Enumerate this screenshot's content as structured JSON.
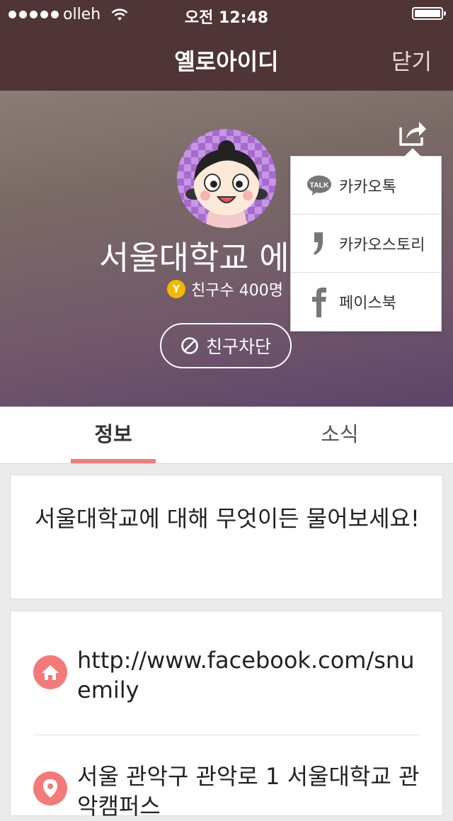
{
  "status": {
    "carrier": "olleh",
    "time": "오전 12:48"
  },
  "nav": {
    "title": "옐로아이디",
    "close_label": "닫기"
  },
  "profile": {
    "name": "서울대학교 에",
    "friends_badge": "Y",
    "friends_text": "친구수 400명",
    "block_label": "친구차단"
  },
  "share_menu": {
    "items": [
      {
        "icon": "kakaotalk-icon",
        "label": "카카오톡"
      },
      {
        "icon": "kakaostory-icon",
        "label": "카카오스토리"
      },
      {
        "icon": "facebook-icon",
        "label": "페이스북"
      }
    ]
  },
  "tabs": [
    {
      "label": "정보",
      "active": true
    },
    {
      "label": "소식",
      "active": false
    }
  ],
  "info": {
    "description": "서울대학교에 대해 무엇이든 물어보세요!",
    "homepage": "http://www.facebook.com/snuemily",
    "address": "서울 관악구 관악로 1 서울대학교 관악캠퍼스"
  },
  "colors": {
    "topbar": "#4f3536",
    "accent": "#f47a7a",
    "badge": "#f5b700"
  }
}
